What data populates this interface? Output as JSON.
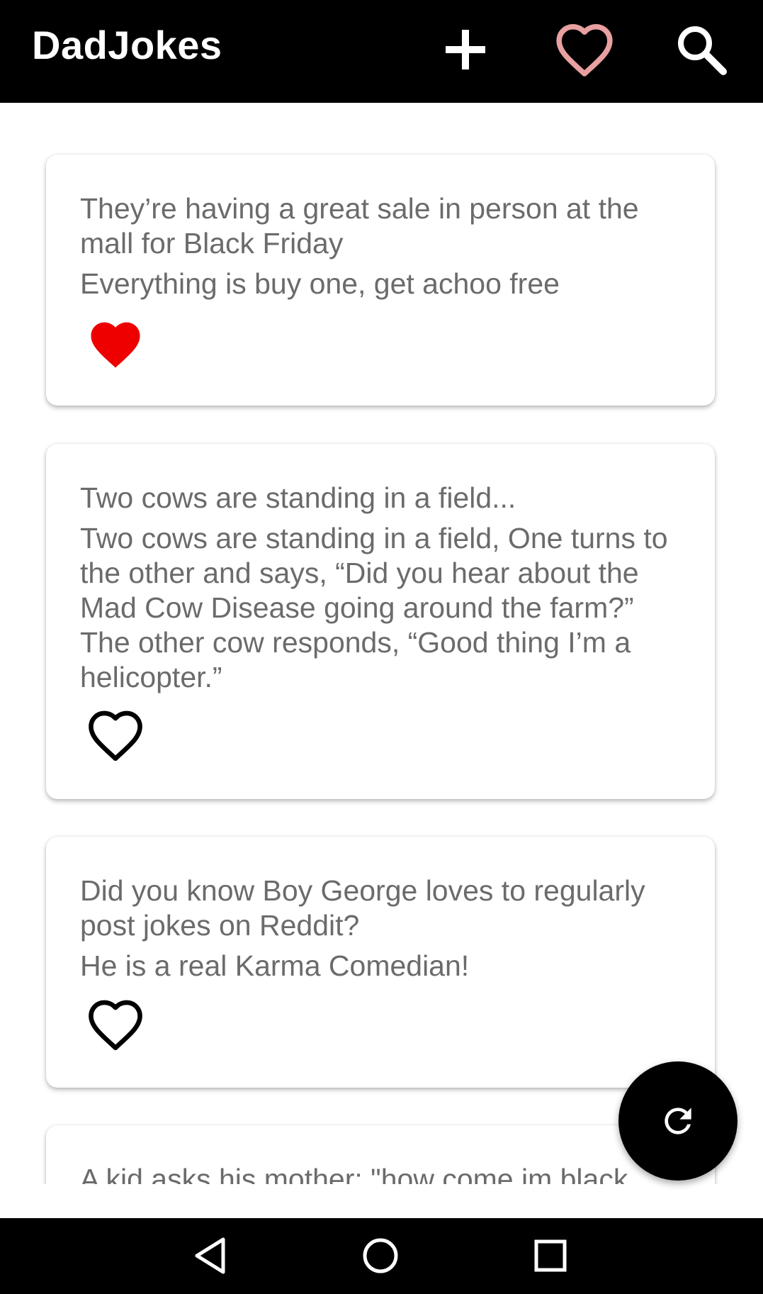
{
  "app": {
    "title": "DadJokes"
  },
  "toolbar": {
    "icons": [
      "plus-icon",
      "heart-outline-icon",
      "search-icon"
    ],
    "favorites_icon_color": "#e8a0a0"
  },
  "jokes": [
    {
      "setup": "They’re having a great sale in person at the mall for Black Friday",
      "punchline": "Everything is buy one, get achoo free",
      "favorited": true
    },
    {
      "setup": "Two cows are standing in a field...",
      "punchline": "Two cows are standing in a field, One turns to the other and says, “Did you hear about the Mad Cow Disease going around the farm?” The other cow responds, “Good thing I’m a helicopter.”",
      "favorited": false
    },
    {
      "setup": "Did you know Boy George loves to regularly post jokes on Reddit?",
      "punchline": "He is a real Karma Comedian!",
      "favorited": false
    },
    {
      "setup": "A kid asks his mother: \"how come im black",
      "punchline": "",
      "favorited": false
    }
  ],
  "colors": {
    "favorite_filled": "#ee0000",
    "appbar": "#000000",
    "text": "#6b6b6b"
  },
  "fab": {
    "icon": "refresh-icon"
  },
  "navigation": {
    "icons": [
      "back-icon",
      "home-icon",
      "recent-apps-icon"
    ]
  }
}
